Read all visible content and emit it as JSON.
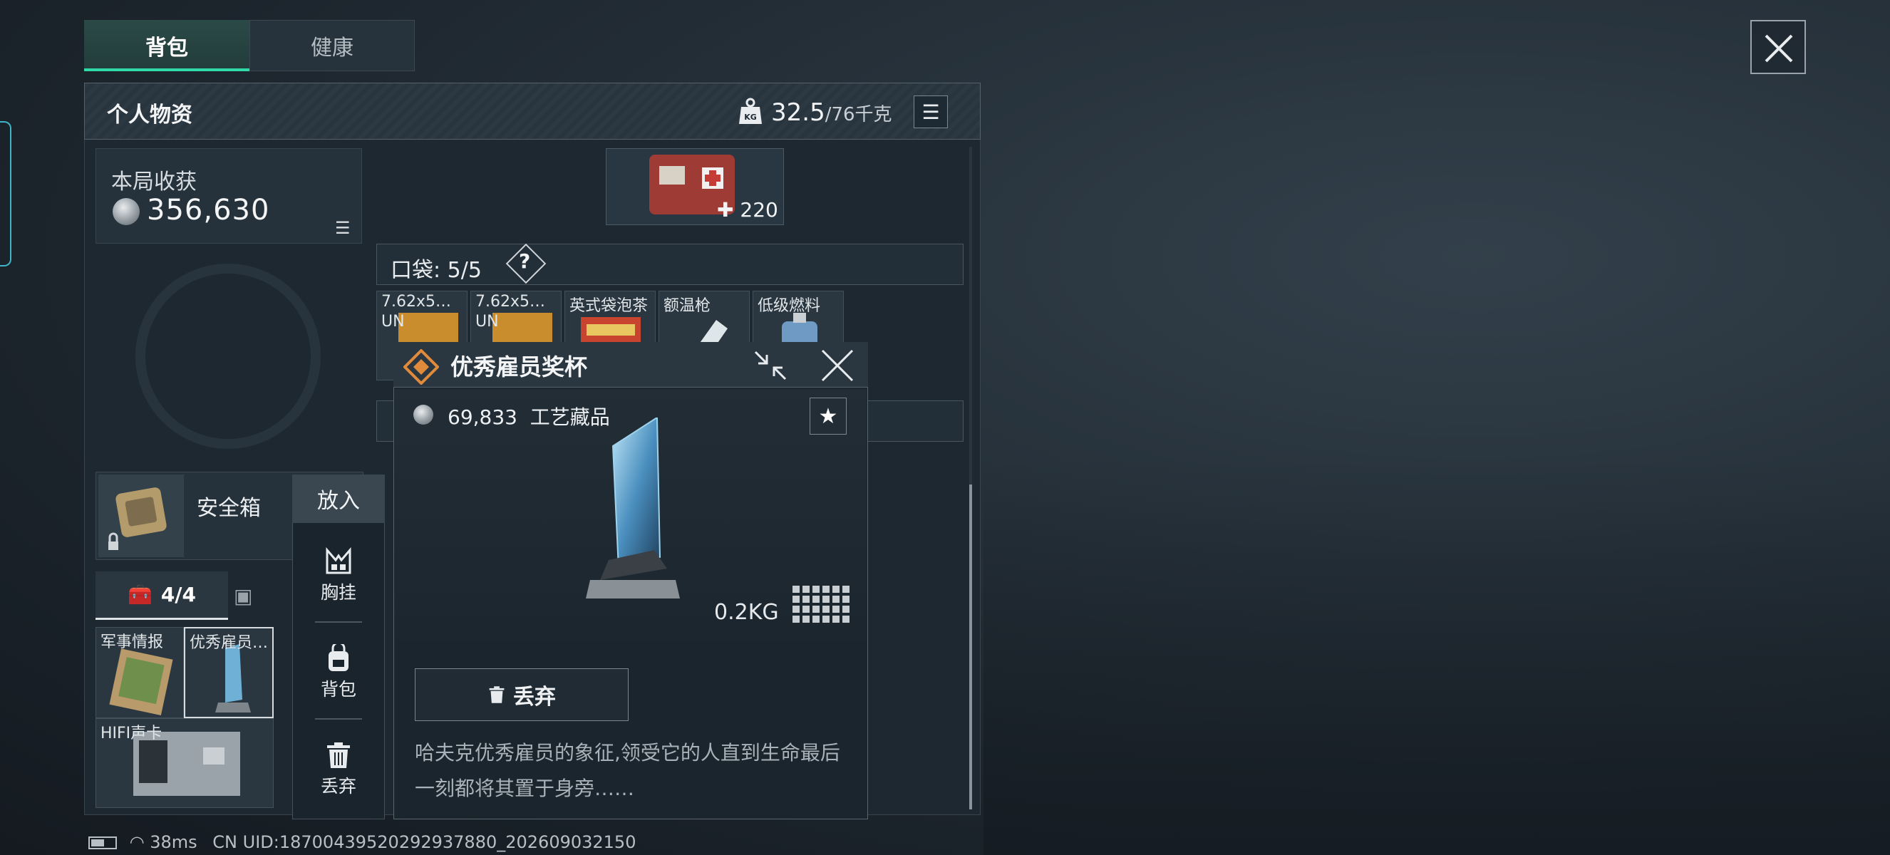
{
  "tabs": {
    "backpack": "背包",
    "health": "健康"
  },
  "panel": {
    "title": "个人物资",
    "weight_current": "32.5",
    "weight_max": "/76千克",
    "weight_icon": "kg-weight-icon"
  },
  "earnings": {
    "label": "本局收获",
    "value": "356,630"
  },
  "safebox": {
    "label": "安全箱"
  },
  "subtabs": {
    "box_count": "4/4",
    "other_count": "4"
  },
  "slots": [
    {
      "label": "军事情报"
    },
    {
      "label": "优秀雇员…"
    },
    {
      "label": "HIFI声卡"
    }
  ],
  "context_menu": {
    "header": "放入",
    "items": [
      "胸挂",
      "背包",
      "丢弃"
    ]
  },
  "kit": {
    "count": "220"
  },
  "pocket": {
    "label": "口袋:",
    "count": "5/5",
    "help": "?"
  },
  "pocket_items": [
    {
      "label": "7.62x5…",
      "sub": "UN"
    },
    {
      "label": "7.62x5…",
      "sub": "UN"
    },
    {
      "label": "英式袋泡茶"
    },
    {
      "label": "额温枪"
    },
    {
      "label": "低级燃料"
    }
  ],
  "item_detail": {
    "title": "优秀雇员奖杯",
    "price": "69,833",
    "category": "工艺藏品",
    "weight": "0.2KG",
    "discard_label": "丢弃",
    "description": "哈夫克优秀雇员的象征,领受它的人直到生命最后一刻都将其置于身旁……"
  },
  "status_bar": {
    "ping": "38ms",
    "uid": "CN UID:18700439520292937880_202609032150"
  },
  "colors": {
    "accent": "#2fd9a8",
    "brand_orange": "#e08a3c",
    "panel_bg": "#1d2831"
  }
}
